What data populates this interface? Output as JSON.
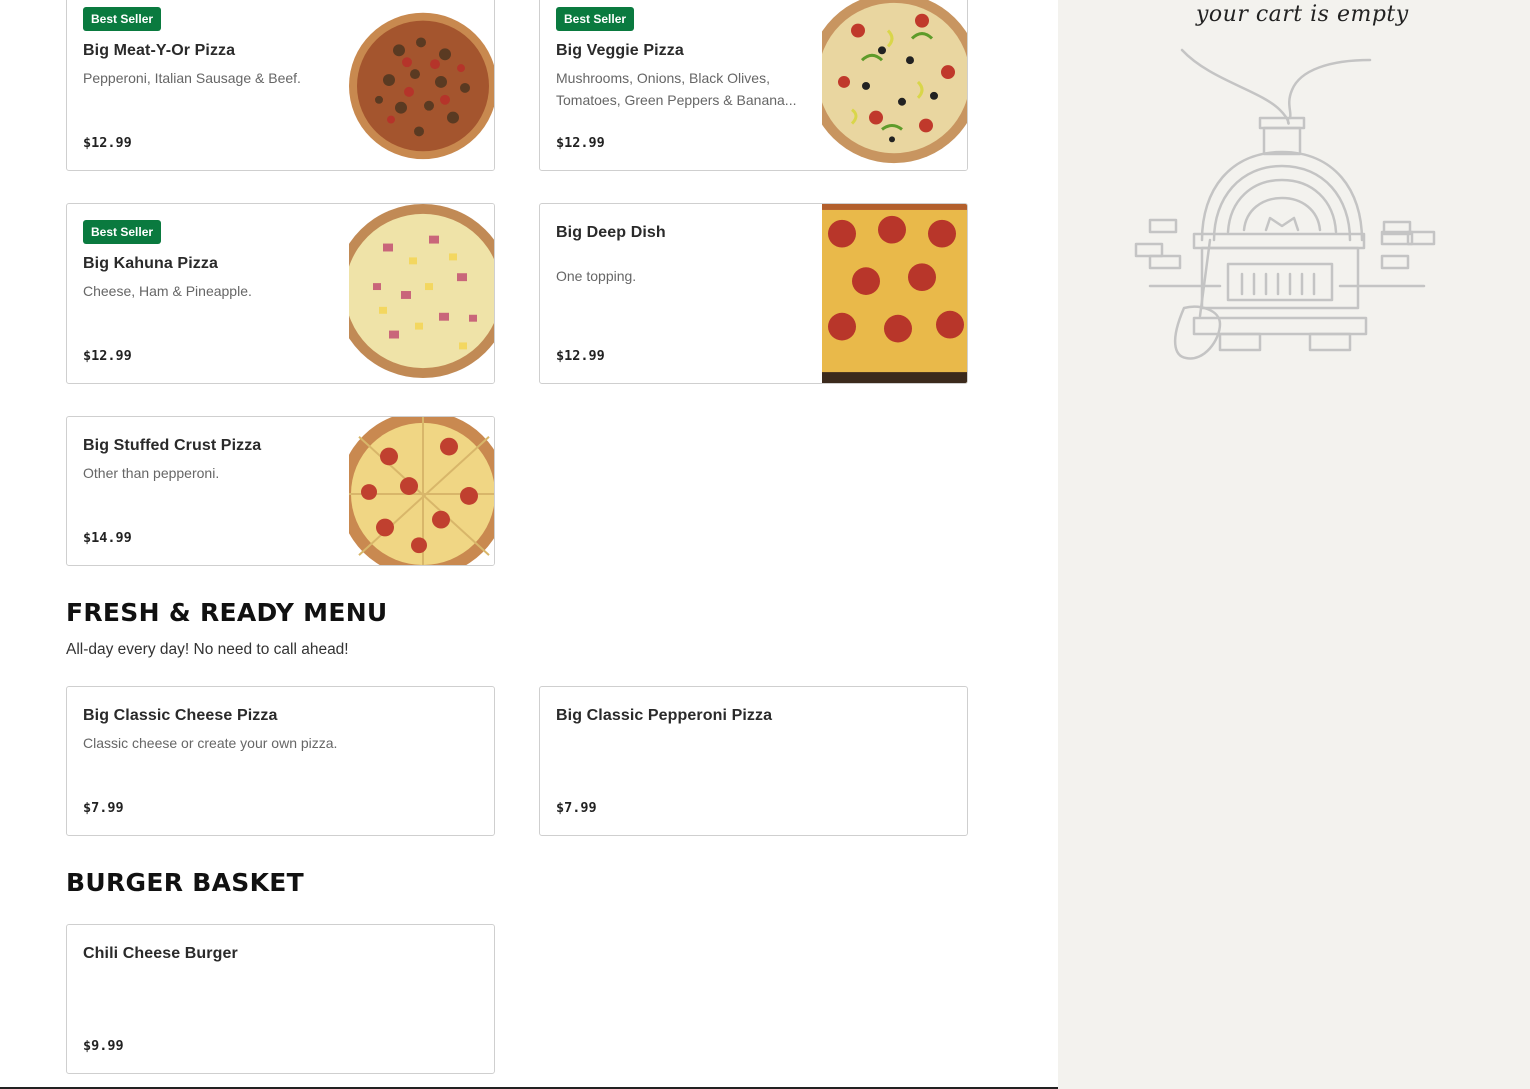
{
  "cart": {
    "empty_text": "your cart is empty"
  },
  "menu_items_top": [
    {
      "badge": "Best Seller",
      "name": "Big Meat-Y-Or Pizza",
      "desc": "Pepperoni, Italian Sausage & Beef.",
      "price": "$12.99"
    },
    {
      "badge": "Best Seller",
      "name": "Big Veggie Pizza",
      "desc1": "Mushrooms, Onions, Black Olives,",
      "desc2": "Tomatoes, Green Peppers & Banana...",
      "price": "$12.99"
    },
    {
      "badge": "Best Seller",
      "name": "Big Kahuna Pizza",
      "desc": "Cheese, Ham & Pineapple.",
      "price": "$12.99"
    },
    {
      "name": "Big Deep Dish",
      "desc": "One topping.",
      "price": "$12.99"
    },
    {
      "name": "Big Stuffed Crust Pizza",
      "desc": "Other than pepperoni.",
      "price": "$14.99"
    }
  ],
  "fresh_ready": {
    "title": "FRESH & READY MENU",
    "subtitle": "All-day every day! No need to call ahead!",
    "items": [
      {
        "name": "Big Classic Cheese Pizza",
        "desc": "Classic cheese or create your own pizza.",
        "price": "$7.99"
      },
      {
        "name": "Big Classic Pepperoni Pizza",
        "price": "$7.99"
      }
    ]
  },
  "burger_basket": {
    "title": "BURGER BASKET",
    "items": [
      {
        "name": "Chili Cheese Burger",
        "price": "$9.99"
      }
    ]
  },
  "colors": {
    "badge": "#0a7a3f",
    "cart_bg": "#f3f2ee"
  },
  "icons": [
    "pizza-image",
    "pizza-oven-illustration"
  ]
}
